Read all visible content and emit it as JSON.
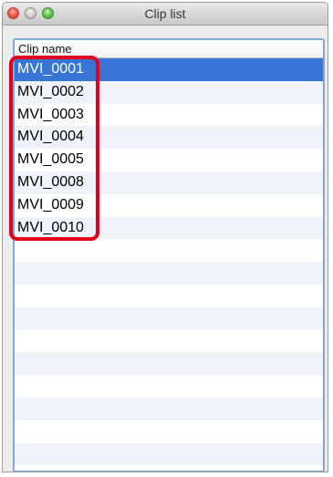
{
  "window": {
    "title": "Clip list"
  },
  "table": {
    "column_header": "Clip name",
    "selected_index": 0,
    "clips": [
      "MVI_0001",
      "MVI_0002",
      "MVI_0003",
      "MVI_0004",
      "MVI_0005",
      "MVI_0008",
      "MVI_0009",
      "MVI_0010"
    ],
    "empty_rows": 11
  },
  "annotation": {
    "highlight_color": "#e3001b"
  },
  "colors": {
    "selection": "#3876d6",
    "alt_row": "#eef3fb",
    "focus_ring": "#7fa7d8"
  }
}
